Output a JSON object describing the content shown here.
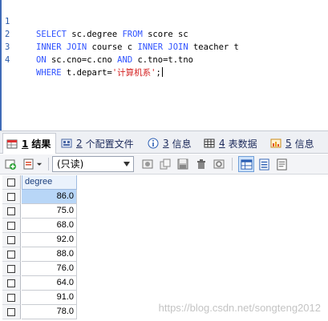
{
  "editor": {
    "lines": [
      {
        "num": "1",
        "parts": [
          {
            "t": "SELECT",
            "k": "kw"
          },
          {
            "t": " sc.degree ",
            "k": ""
          },
          {
            "t": "FROM",
            "k": "kw"
          },
          {
            "t": " score sc",
            "k": ""
          }
        ]
      },
      {
        "num": "2",
        "parts": [
          {
            "t": "INNER JOIN",
            "k": "kw"
          },
          {
            "t": " course c ",
            "k": ""
          },
          {
            "t": "INNER JOIN",
            "k": "kw"
          },
          {
            "t": " teacher t",
            "k": ""
          }
        ]
      },
      {
        "num": "3",
        "parts": [
          {
            "t": "ON",
            "k": "kw"
          },
          {
            "t": " sc.cno=c.cno ",
            "k": ""
          },
          {
            "t": "AND",
            "k": "kw"
          },
          {
            "t": " c.tno=t.tno",
            "k": ""
          }
        ]
      },
      {
        "num": "4",
        "parts": [
          {
            "t": "WHERE",
            "k": "kw"
          },
          {
            "t": " t.depart=",
            "k": ""
          },
          {
            "t": "'计算机系'",
            "k": "str"
          },
          {
            "t": ";",
            "k": ""
          }
        ]
      }
    ]
  },
  "tabs": [
    {
      "num": "1",
      "label": "结果",
      "icon": "result-grid-icon"
    },
    {
      "num": "2",
      "label": "个配置文件",
      "icon": "profile-icon"
    },
    {
      "num": "3",
      "label": "信息",
      "icon": "info-icon"
    },
    {
      "num": "4",
      "label": "表数据",
      "icon": "table-data-icon"
    },
    {
      "num": "5",
      "label": "信息",
      "icon": "info-chart-icon"
    }
  ],
  "toolbar": {
    "mode_value": "(只读)"
  },
  "grid": {
    "column": "degree",
    "rows": [
      "86.0",
      "75.0",
      "68.0",
      "92.0",
      "88.0",
      "76.0",
      "64.0",
      "91.0",
      "78.0"
    ]
  },
  "watermark": "https://blog.csdn.net/songteng2012",
  "colors": {
    "keyword": "#2f52ff",
    "string": "#d42020",
    "selection": "#b8d6f7"
  }
}
